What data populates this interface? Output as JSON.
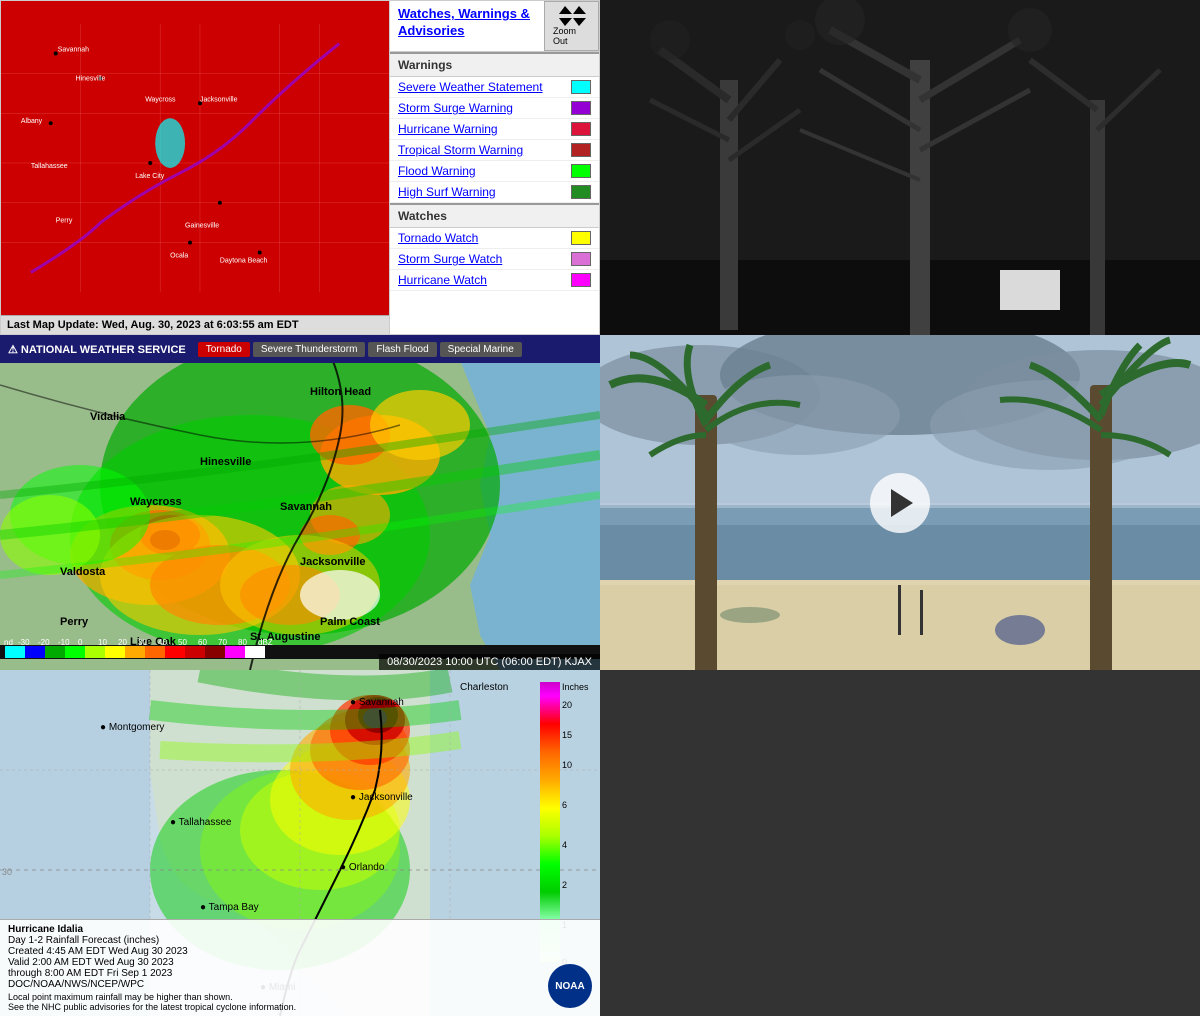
{
  "legend": {
    "title": "Watches, Warnings & Advisories",
    "items": [
      {
        "label": "Severe Weather Statement",
        "color": "#00ffff"
      },
      {
        "label": "Storm Surge Warning",
        "color": "#9400d3"
      },
      {
        "label": "Hurricane Warning",
        "color": "#dc143c"
      },
      {
        "label": "Tropical Storm Warning",
        "color": "#b22222"
      },
      {
        "label": "Flood Warning",
        "color": "#00ff00"
      },
      {
        "label": "High Surf Warning",
        "color": "#228b22"
      },
      {
        "label": "Tornado Watch",
        "color": "#ffff00"
      },
      {
        "label": "Storm Surge Watch",
        "color": "#da70d6"
      },
      {
        "label": "Hurricane Watch",
        "color": "#ff00ff"
      }
    ],
    "zoom_label": "Zoom Out"
  },
  "map": {
    "timestamp": "Last Map Update: Wed, Aug. 30, 2023 at 6:03:55 am EDT"
  },
  "nws": {
    "title": "NATIONAL WEATHER SERVICE",
    "tabs": [
      "Tornado",
      "Severe Thunderstorm",
      "Flash Flood",
      "Special Marine"
    ]
  },
  "radar": {
    "timestamp": "08/30/2023 10:00 UTC (06:00 EDT)  KJAX"
  },
  "nightcam": {
    "alt": "Night camera view - grayscale trees"
  },
  "beach": {
    "alt": "Beach webcam with palm trees"
  },
  "rainfall": {
    "title": "Hurricane Idalia",
    "subtitle": "Day 1-2 Rainfall Forecast (inches)",
    "created": "Created 4:45 AM EDT Wed Aug 30 2023",
    "valid": "Valid 2:00 AM EDT Wed Aug 30 2023",
    "through": "through 8:00 AM EDT Fri Sep 1 2023",
    "credit": "DOC/NOAA/NWS/NCEP/WPC",
    "note": "Local point maximum rainfall may be higher than shown.",
    "note2": "See the NHC public advisories for the latest tropical cyclone information.",
    "scale_title": "Inches",
    "cities": [
      "Montgomery",
      "Savannah",
      "Charleston",
      "Tallahassee",
      "Jacksonville",
      "Tampa Bay",
      "Orlando",
      "Miami"
    ],
    "scale_values": [
      "20",
      "15",
      "10",
      "6",
      "4",
      "2",
      "1"
    ]
  }
}
